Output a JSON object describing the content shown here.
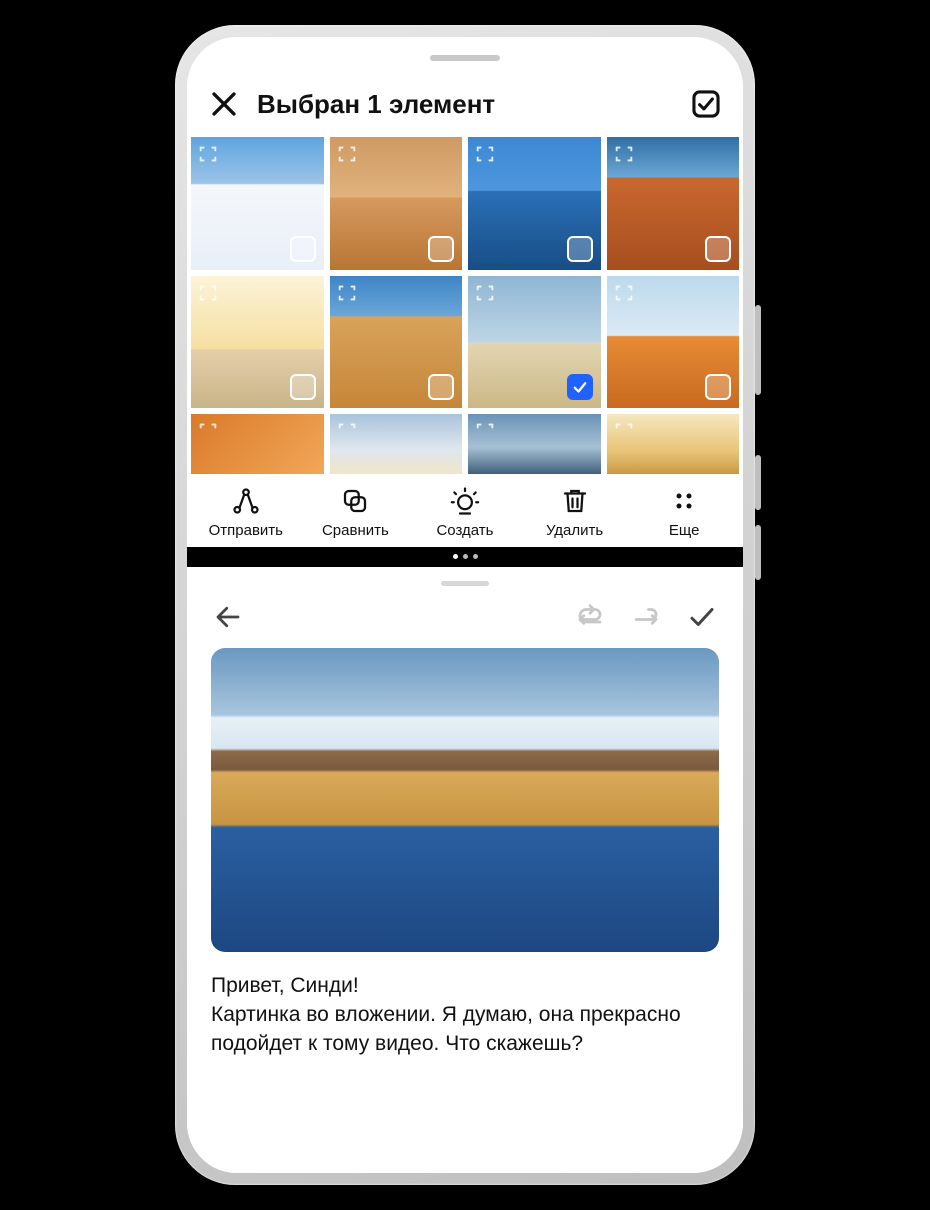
{
  "header": {
    "title": "Выбран 1 элемент"
  },
  "grid": {
    "selected_index": 6
  },
  "toolbar": {
    "send": "Отправить",
    "compare": "Сравнить",
    "create": "Создать",
    "delete": "Удалить",
    "more": "Еще"
  },
  "compose": {
    "text_line1": "Привет, Синди!",
    "text_line2": "Картинка во вложении. Я думаю, она прекрасно подойдет к тому видео. Что скажешь?"
  }
}
